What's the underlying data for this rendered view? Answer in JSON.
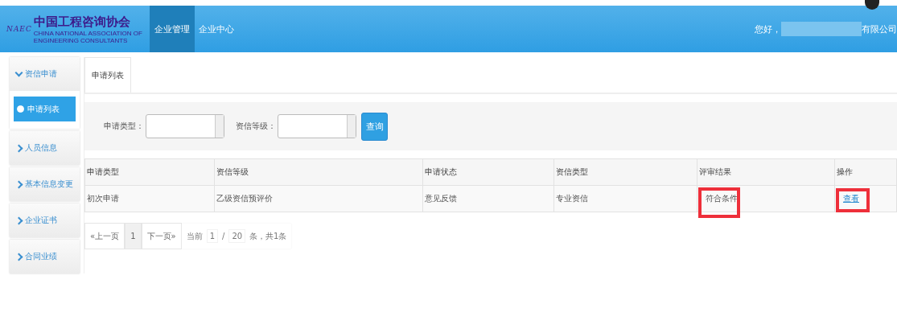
{
  "header": {
    "logo": {
      "mark": "NAEC",
      "title": "中国工程咨询协会",
      "subtitle": "CHINA NATIONAL ASSOCIATION OF ENGINEERING CONSULTANTS"
    },
    "nav": [
      {
        "label": "企业管理",
        "selected": true
      },
      {
        "label": "企业中心",
        "selected": false
      }
    ],
    "greeting": "您好，",
    "company_suffix": "有限公司"
  },
  "sidebar": {
    "items": [
      {
        "label": "资信申请",
        "expanded": true,
        "children": [
          {
            "label": "申请列表",
            "selected": true
          }
        ]
      },
      {
        "label": "人员信息",
        "expanded": false
      },
      {
        "label": "基本信息变更",
        "expanded": false
      },
      {
        "label": "企业证书",
        "expanded": false
      },
      {
        "label": "合同业绩",
        "expanded": false
      }
    ]
  },
  "tabs": [
    {
      "label": "申请列表",
      "selected": true
    }
  ],
  "filters": [
    {
      "label": "申请类型：",
      "kind": "select"
    },
    {
      "label": "资信等级：",
      "kind": "select"
    }
  ],
  "search_button": "查询",
  "table": {
    "columns": [
      "申请类型",
      "资信等级",
      "申请状态",
      "资信类型",
      "评审结果",
      "操作"
    ],
    "rows": [
      {
        "cells": [
          {
            "text": "初次申请",
            "kind": "text",
            "highlighted": false
          },
          {
            "text": "乙级资信预评价",
            "kind": "text",
            "highlighted": false
          },
          {
            "text": "意见反馈",
            "kind": "text",
            "highlighted": false
          },
          {
            "text": "专业资信",
            "kind": "text",
            "highlighted": false
          },
          {
            "text": "符合条件",
            "kind": "text",
            "highlighted": true
          },
          {
            "text": "查看",
            "kind": "link",
            "highlighted": true
          }
        ]
      }
    ]
  },
  "pagination": {
    "prev": "«上一页",
    "pages": [
      {
        "label": "1",
        "selected": true
      }
    ],
    "next": "下一页»",
    "current_label": "当前",
    "current_page": "1",
    "separator": "/",
    "page_size": "20",
    "summary": "条，共1条"
  }
}
